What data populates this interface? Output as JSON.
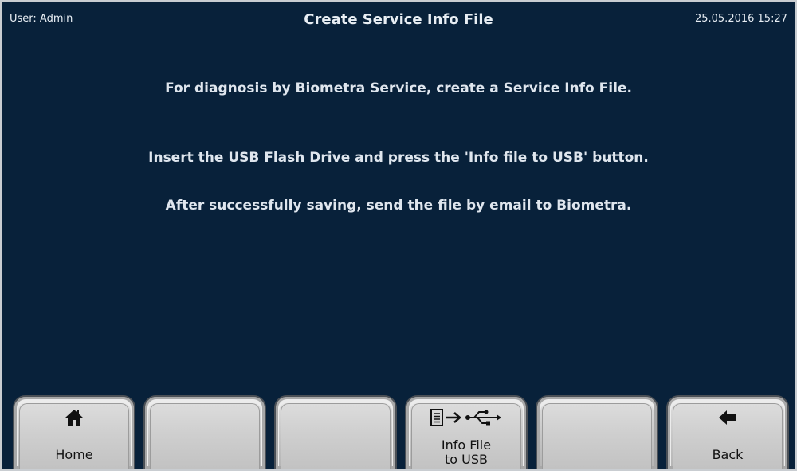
{
  "header": {
    "user": "User: Admin",
    "title": "Create Service Info File",
    "datetime": "25.05.2016  15:27"
  },
  "messages": {
    "line1": "For diagnosis by Biometra Service, create a Service Info File.",
    "line2": "Insert the USB Flash Drive and press the 'Info file to USB' button.",
    "line3": "After successfully saving, send the file by email to Biometra."
  },
  "buttons": {
    "home": {
      "label": "Home",
      "icon": "home-icon"
    },
    "info_file": {
      "label_line1": "Info File",
      "label_line2": "to USB",
      "icon": "file-to-usb-icon"
    },
    "back": {
      "label": "Back",
      "icon": "arrow-left-icon"
    }
  },
  "colors": {
    "background": "#08213a",
    "text": "#e8eef4",
    "button_face": "#c6c6c6"
  }
}
